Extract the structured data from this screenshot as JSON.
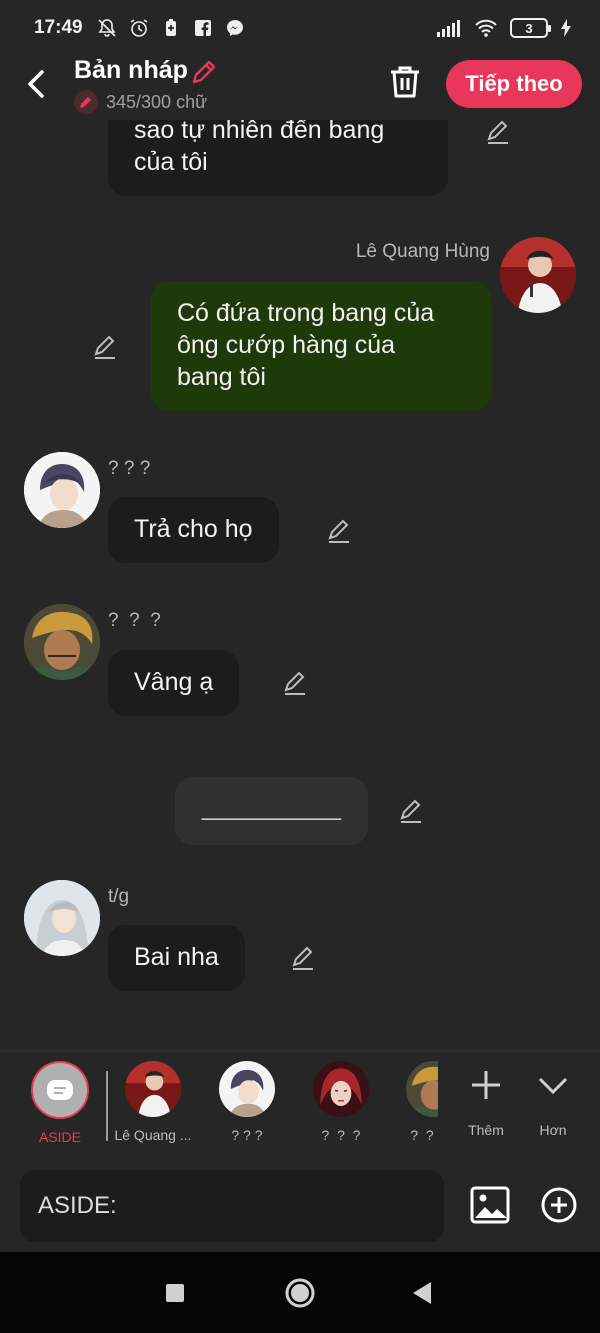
{
  "status_bar": {
    "time": "17:49",
    "battery": "3"
  },
  "header": {
    "title": "Bản nháp",
    "word_count": "345/300 chữ",
    "next_button": "Tiếp theo"
  },
  "messages": [
    {
      "id": "m0",
      "lines": [
        "sao tự nhiên đến bang",
        "của tôi"
      ]
    },
    {
      "id": "m1",
      "sender": "Lê Quang Hùng",
      "lines": [
        "Có đứa trong bang của",
        "ông cướp hàng của",
        "bang tôi"
      ]
    },
    {
      "id": "m2",
      "sender": "? ? ?",
      "lines": [
        "Trả cho họ"
      ]
    },
    {
      "id": "m3",
      "sender": "?  ?  ?",
      "lines": [
        "Vâng ạ"
      ]
    },
    {
      "id": "m4",
      "lines": [
        "__________"
      ]
    },
    {
      "id": "m5",
      "sender": "t/g",
      "lines": [
        "Bai nha"
      ]
    }
  ],
  "cast": {
    "aside_label": "ASIDE",
    "characters": [
      "Lê Quang ...",
      "? ? ?",
      "?  ?  ?",
      "?  ?"
    ],
    "add_label": "Thêm",
    "more_label": "Hơn"
  },
  "input": {
    "value": "ASIDE:"
  },
  "colors": {
    "accent": "#e8375a",
    "my_bubble": "#1f3a0a",
    "bubble": "#1c1c1c",
    "background": "#262626"
  }
}
